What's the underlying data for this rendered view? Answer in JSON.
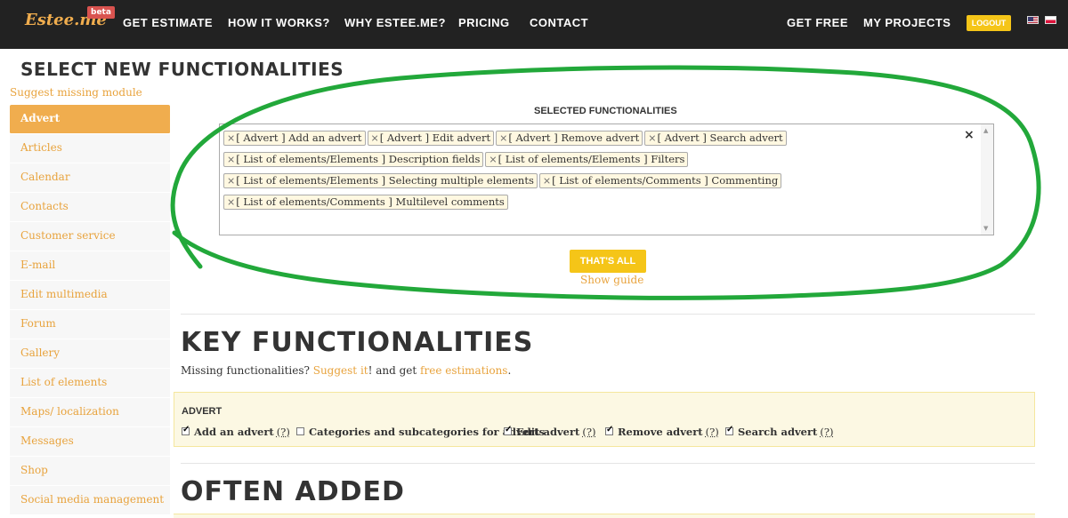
{
  "nav": {
    "logo": "Estee.me",
    "beta": "beta",
    "links": [
      "GET ESTIMATE",
      "HOW IT WORKS?",
      "WHY ESTEE.ME?",
      "PRICING",
      "CONTACT"
    ],
    "right_links": [
      "GET FREE",
      "MY PROJECTS"
    ],
    "logout": "LOGOUT"
  },
  "page": {
    "title": "SELECT NEW FUNCTIONALITIES",
    "suggest_missing": "Suggest missing module"
  },
  "sidebar": {
    "items": [
      "Advert",
      "Articles",
      "Calendar",
      "Contacts",
      "Customer service",
      "E-mail",
      "Edit multimedia",
      "Forum",
      "Gallery",
      "List of elements",
      "Maps/ localization",
      "Messages",
      "Shop",
      "Social media management"
    ],
    "active": "Advert"
  },
  "selected": {
    "heading": "SELECTED FUNCTIONALITIES",
    "remove_symbol": "×",
    "clear_symbol": "×",
    "tags": [
      "[ Advert ] Add an advert",
      "[ Advert ] Edit advert",
      "[ Advert ] Remove advert",
      "[ Advert ] Search advert",
      "[ List of elements/Elements ] Description fields",
      "[ List of elements/Elements ] Filters",
      "[ List of elements/Elements ] Selecting multiple elements",
      "[ List of elements/Comments ] Commenting",
      "[ List of elements/Comments ] Multilevel comments"
    ],
    "thats_all": "THAT'S ALL",
    "show_guide": "Show guide"
  },
  "key": {
    "title": "KEY FUNCTIONALITIES",
    "missing_pre": "Missing functionalities? ",
    "suggest_link": "Suggest it",
    "missing_mid": "! and get ",
    "free_link": "free estimations",
    "missing_post": "."
  },
  "advert": {
    "title": "ADVERT",
    "help": "(?)",
    "items": [
      {
        "label": "Add an advert",
        "checked": true,
        "help": true
      },
      {
        "label": "Categories and subcategories for adverts",
        "checked": false,
        "help": false
      },
      {
        "label": "Edit advert",
        "checked": true,
        "help": true
      },
      {
        "label": "Remove advert",
        "checked": true,
        "help": true
      },
      {
        "label": "Search advert",
        "checked": true,
        "help": true
      }
    ]
  },
  "often": {
    "title": "OFTEN ADDED"
  },
  "colors": {
    "accent": "#f0ad4e",
    "button": "#f5c518",
    "annotation": "#22a83a"
  }
}
